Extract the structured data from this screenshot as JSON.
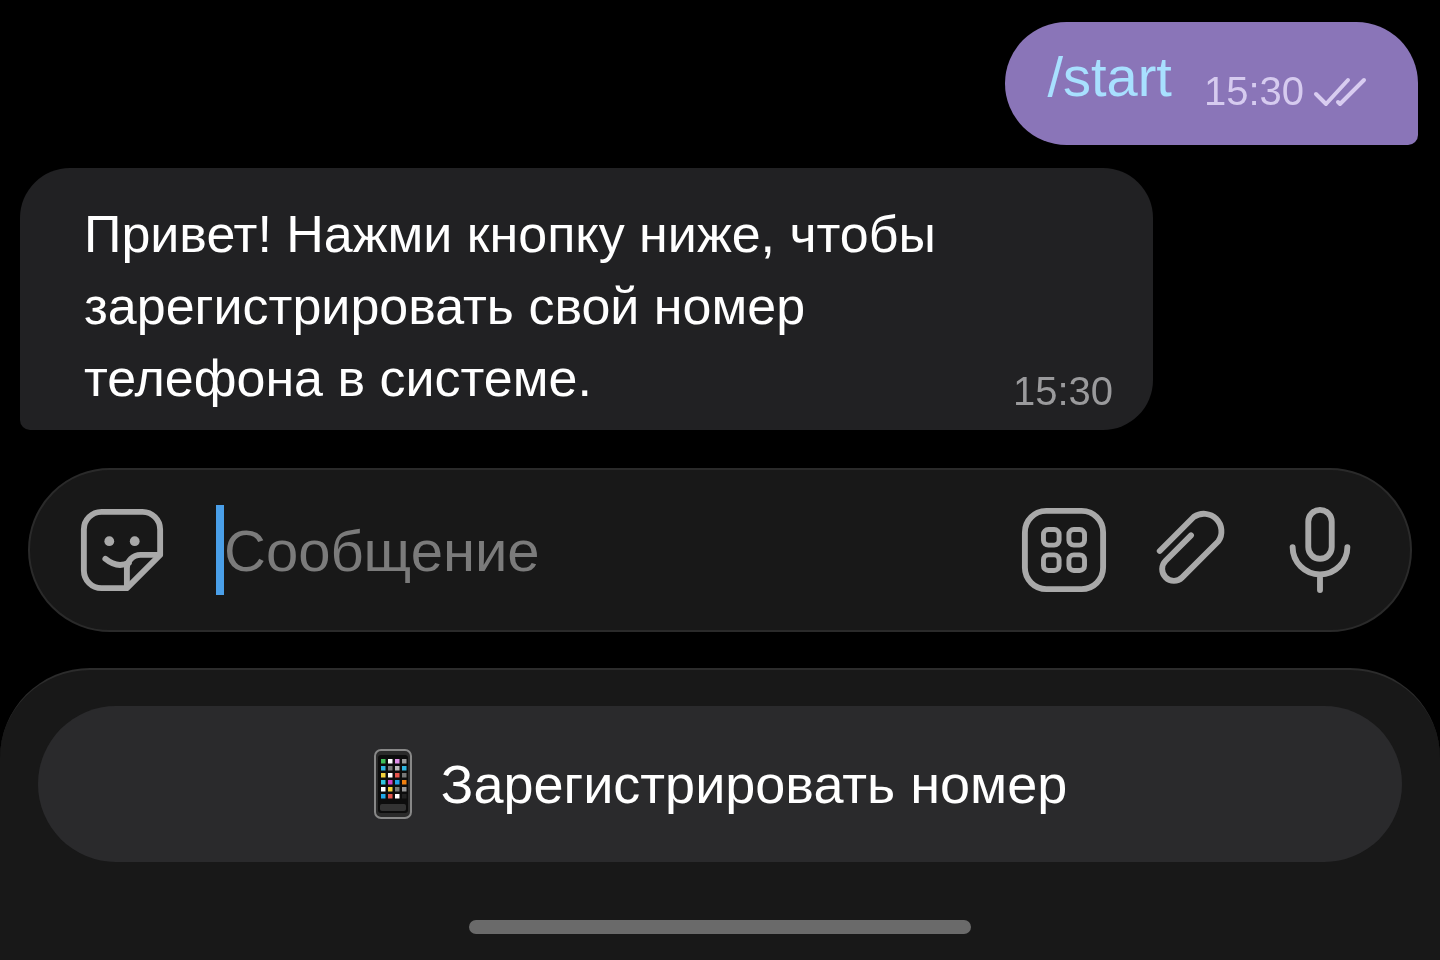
{
  "messages": [
    {
      "kind": "outgoing",
      "text": "/start",
      "time": "15:30",
      "read": true
    },
    {
      "kind": "incoming",
      "text": "Привет! Нажми кнопку ниже, чтобы зарегистрировать свой номер телефона в системе.",
      "time": "15:30"
    }
  ],
  "composer": {
    "placeholder": "Сообщение"
  },
  "keyboard": {
    "buttons": [
      {
        "label": "Зарегистрировать номер"
      }
    ]
  }
}
